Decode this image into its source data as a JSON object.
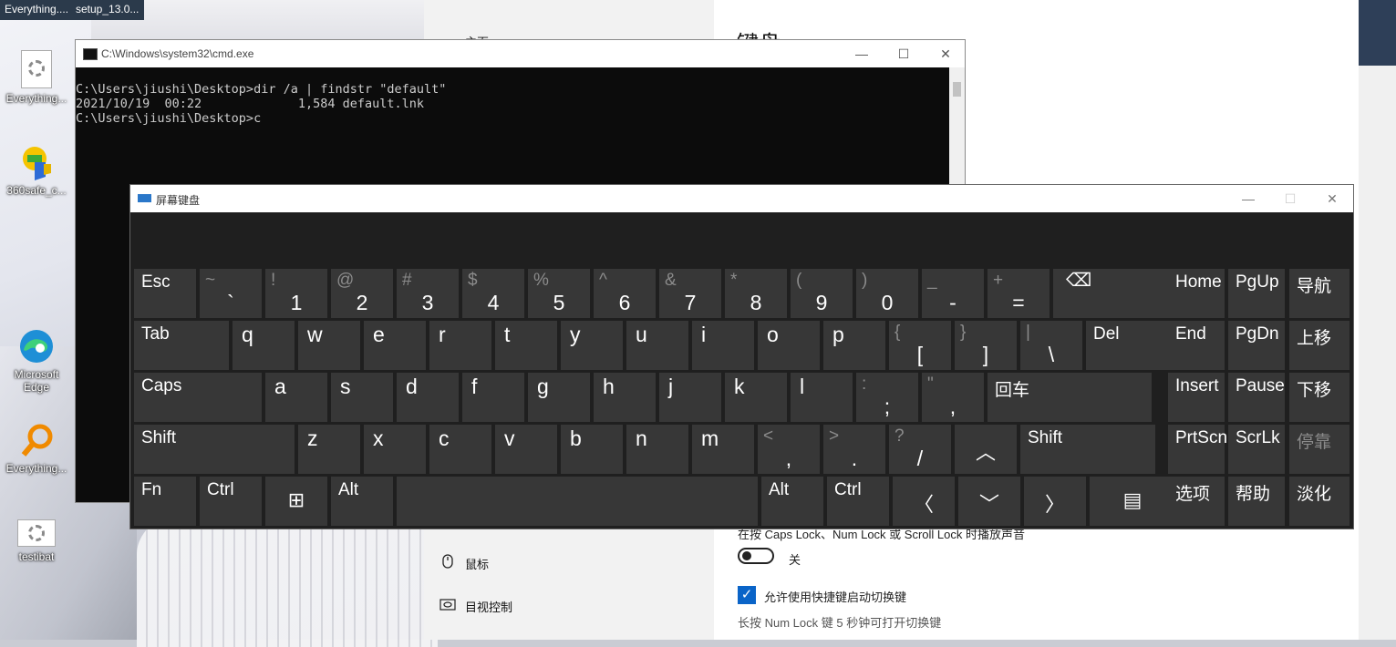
{
  "taskbar": {
    "items": [
      "Everything....",
      "setup_13.0..."
    ]
  },
  "desktop_icons": [
    {
      "label": "Everything...",
      "icon": "settings-file-icon"
    },
    {
      "label": "360safe_c...",
      "icon": "360-safe-icon"
    },
    {
      "label": "Microsoft Edge",
      "icon": "edge-icon"
    },
    {
      "label": "Everything...",
      "icon": "search-magnifier-icon"
    },
    {
      "label": "testibat",
      "icon": "batch-file-icon"
    }
  ],
  "settings": {
    "title": "键盘",
    "nav_top": "主页",
    "nav": [
      {
        "label": "鼠标",
        "icon": "mouse-icon"
      },
      {
        "label": "目视控制",
        "icon": "eye-control-icon"
      }
    ],
    "toggle_label_text": "在按 Caps Lock、Num Lock 或 Scroll Lock 时播放声音",
    "toggle_state": "关",
    "checkbox_label": "允许使用快捷键启动切换键",
    "checkbox_checked": true,
    "hint": "长按 Num Lock 键 5 秒钟可打开切换键"
  },
  "cmd": {
    "title": "C:\\Windows\\system32\\cmd.exe",
    "lines": [
      "C:\\Users\\jiushi\\Desktop>dir /a | findstr \"default\"",
      "2021/10/19  00:22             1,584 default.lnk",
      "",
      "C:\\Users\\jiushi\\Desktop>c"
    ],
    "minimize": "—",
    "maximize": "☐",
    "close": "✕"
  },
  "osk": {
    "title": "屏幕键盘",
    "rows": [
      [
        {
          "name": "esc",
          "label": "Esc"
        },
        {
          "name": "backtick",
          "shift": "~",
          "main": "`"
        },
        {
          "name": "1",
          "shift": "!",
          "main": "1"
        },
        {
          "name": "2",
          "shift": "@",
          "main": "2"
        },
        {
          "name": "3",
          "shift": "#",
          "main": "3"
        },
        {
          "name": "4",
          "shift": "$",
          "main": "4"
        },
        {
          "name": "5",
          "shift": "%",
          "main": "5"
        },
        {
          "name": "6",
          "shift": "^",
          "main": "6"
        },
        {
          "name": "7",
          "shift": "&",
          "main": "7"
        },
        {
          "name": "8",
          "shift": "*",
          "main": "8"
        },
        {
          "name": "9",
          "shift": "(",
          "main": "9"
        },
        {
          "name": "0",
          "shift": ")",
          "main": "0"
        },
        {
          "name": "minus",
          "shift": "_",
          "main": "-"
        },
        {
          "name": "equals",
          "shift": "+",
          "main": "="
        },
        {
          "name": "backspace",
          "label": "⌫"
        },
        {
          "name": "home",
          "label": "Home"
        },
        {
          "name": "pgup",
          "label": "PgUp"
        },
        {
          "name": "nav",
          "label": "导航"
        }
      ],
      [
        {
          "name": "tab",
          "label": "Tab"
        },
        {
          "name": "q",
          "label": "q"
        },
        {
          "name": "w",
          "label": "w"
        },
        {
          "name": "e",
          "label": "e"
        },
        {
          "name": "r",
          "label": "r"
        },
        {
          "name": "t",
          "label": "t"
        },
        {
          "name": "y",
          "label": "y"
        },
        {
          "name": "u",
          "label": "u"
        },
        {
          "name": "i",
          "label": "i"
        },
        {
          "name": "o",
          "label": "o"
        },
        {
          "name": "p",
          "label": "p"
        },
        {
          "name": "lbracket",
          "shift": "{",
          "main": "["
        },
        {
          "name": "rbracket",
          "shift": "}",
          "main": "]"
        },
        {
          "name": "backslash",
          "shift": "|",
          "main": "\\"
        },
        {
          "name": "del",
          "label": "Del"
        },
        {
          "name": "end",
          "label": "End"
        },
        {
          "name": "pgdn",
          "label": "PgDn"
        },
        {
          "name": "move-up",
          "label": "上移"
        }
      ],
      [
        {
          "name": "caps",
          "label": "Caps"
        },
        {
          "name": "a",
          "label": "a"
        },
        {
          "name": "s",
          "label": "s"
        },
        {
          "name": "d",
          "label": "d"
        },
        {
          "name": "f",
          "label": "f"
        },
        {
          "name": "g",
          "label": "g"
        },
        {
          "name": "h",
          "label": "h"
        },
        {
          "name": "j",
          "label": "j"
        },
        {
          "name": "k",
          "label": "k"
        },
        {
          "name": "l",
          "label": "l"
        },
        {
          "name": "semicolon",
          "shift": ":",
          "main": ";"
        },
        {
          "name": "quote",
          "shift": "\"",
          "main": ","
        },
        {
          "name": "enter",
          "label": "回车"
        },
        {
          "name": "insert",
          "label": "Insert"
        },
        {
          "name": "pause",
          "label": "Pause"
        },
        {
          "name": "move-down",
          "label": "下移"
        }
      ],
      [
        {
          "name": "lshift",
          "label": "Shift"
        },
        {
          "name": "z",
          "label": "z"
        },
        {
          "name": "x",
          "label": "x"
        },
        {
          "name": "c",
          "label": "c"
        },
        {
          "name": "v",
          "label": "v"
        },
        {
          "name": "b",
          "label": "b"
        },
        {
          "name": "n",
          "label": "n"
        },
        {
          "name": "m",
          "label": "m"
        },
        {
          "name": "comma",
          "shift": "<",
          "main": ","
        },
        {
          "name": "period",
          "shift": ">",
          "main": "."
        },
        {
          "name": "slash",
          "shift": "?",
          "main": "/"
        },
        {
          "name": "up",
          "label": "︿"
        },
        {
          "name": "rshift",
          "label": "Shift"
        },
        {
          "name": "prtscn",
          "label": "PrtScn"
        },
        {
          "name": "scrlk",
          "label": "ScrLk"
        },
        {
          "name": "dock",
          "label": "停靠"
        }
      ],
      [
        {
          "name": "fn",
          "label": "Fn"
        },
        {
          "name": "lctrl",
          "label": "Ctrl"
        },
        {
          "name": "win",
          "label": "⊞"
        },
        {
          "name": "lalt",
          "label": "Alt"
        },
        {
          "name": "space",
          "label": ""
        },
        {
          "name": "ralt",
          "label": "Alt"
        },
        {
          "name": "rctrl",
          "label": "Ctrl"
        },
        {
          "name": "left",
          "label": "〈"
        },
        {
          "name": "down",
          "label": "﹀"
        },
        {
          "name": "right",
          "label": "〉"
        },
        {
          "name": "menu",
          "label": "▤"
        },
        {
          "name": "options",
          "label": "选项"
        },
        {
          "name": "help",
          "label": "帮助"
        },
        {
          "name": "fade",
          "label": "淡化"
        }
      ]
    ]
  }
}
